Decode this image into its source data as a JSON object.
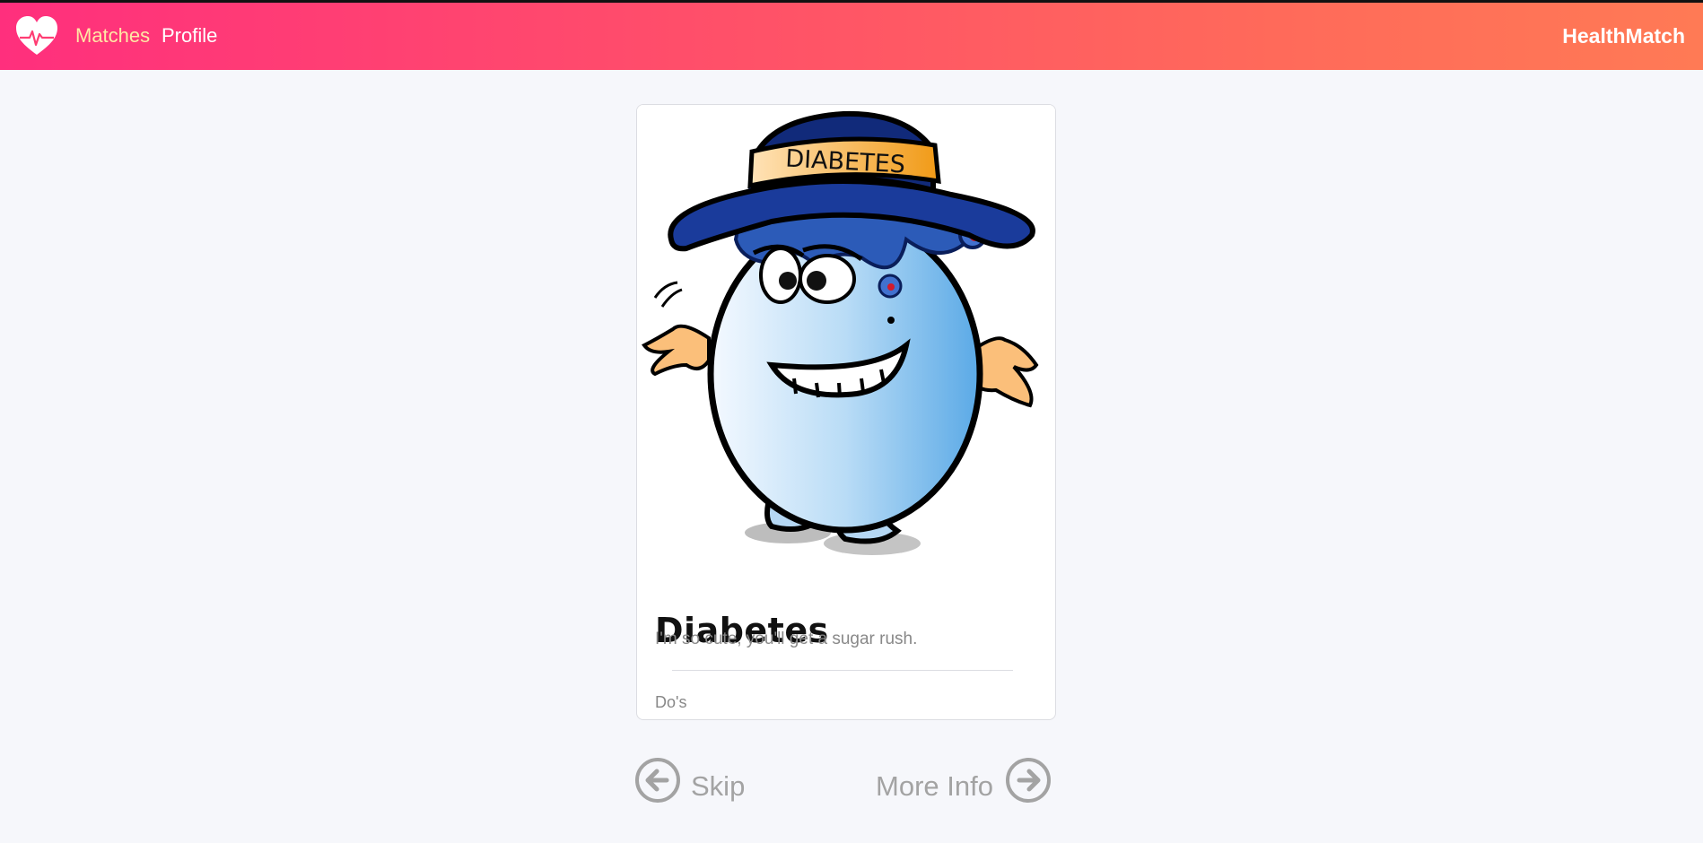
{
  "navbar": {
    "links": [
      {
        "label": "Matches",
        "active": true
      },
      {
        "label": "Profile",
        "active": false
      }
    ],
    "brand": "HealthMatch",
    "logo_icon": "heart-pulse-icon",
    "accent_start": "#ff2f7d",
    "accent_end": "#ff7a55"
  },
  "card": {
    "image_banner_text": "DIABETES",
    "title": "Diabetes",
    "tagline": "I'm so cute, you'll get a sugar rush.",
    "section_label": "Do's"
  },
  "actions": {
    "skip_label": "Skip",
    "skip_icon": "arrow-left-circle-icon",
    "more_label": "More Info",
    "more_icon": "arrow-right-circle-icon"
  }
}
